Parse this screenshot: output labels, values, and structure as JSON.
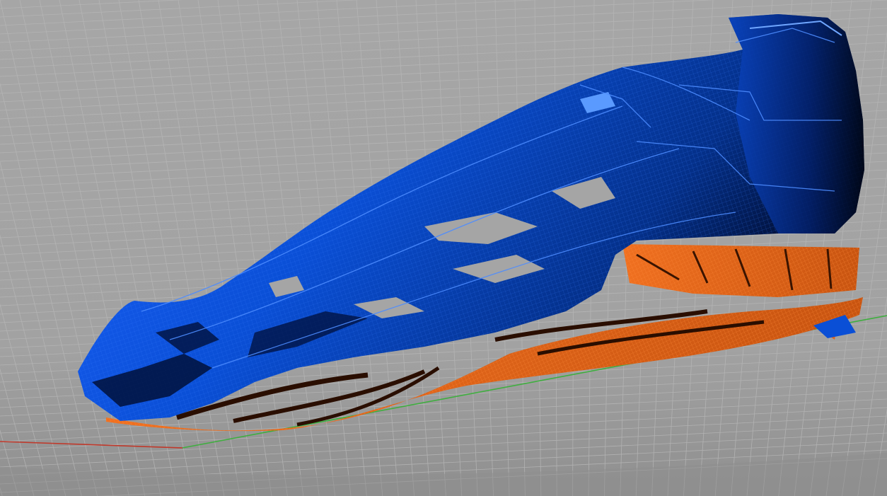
{
  "viewport": {
    "view": "perspective",
    "background_color": "#a3a3a3",
    "grid": true,
    "grid_color": "#b7b7b7",
    "axes": {
      "x_axis_color": "#c0392b",
      "y_axis_color": "#3fae3f"
    }
  },
  "model": {
    "description": "footwear-upper-wireframe",
    "upper_color": "#0a4fd6",
    "upper_shadow_color": "#001a66",
    "upper_edge_color": "#3a7dff",
    "sole_color": "#e0641c",
    "sole_shadow_color": "#3a1400"
  }
}
